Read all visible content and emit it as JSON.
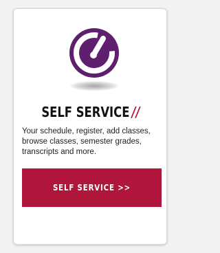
{
  "card": {
    "title": "SELF SERVICE",
    "title_accent": "//",
    "description": "Your schedule, register, add classes, browse classes, semester grades, transcripts and more.",
    "button_label": "SELF SERVICE >>",
    "logo_icon": "power-gauge-icon"
  },
  "colors": {
    "brand_red": "#b0163c",
    "logo_purple": "#5e1f6e",
    "card_background": "#ffffff",
    "page_background": "#f2f2f2"
  }
}
